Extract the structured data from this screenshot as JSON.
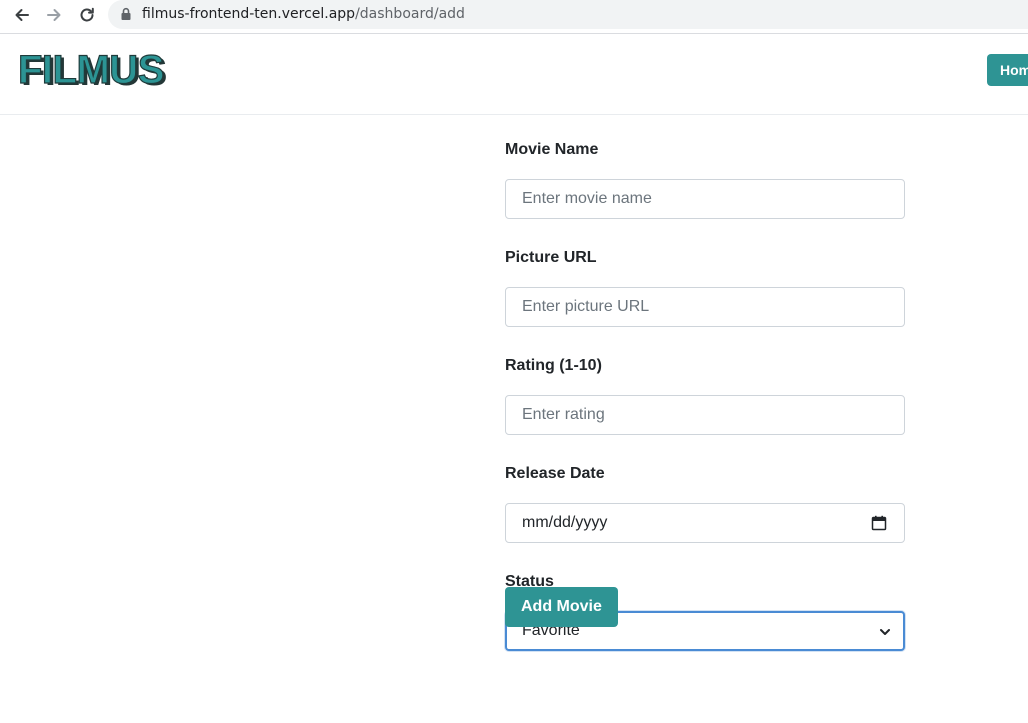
{
  "browser": {
    "url_host": "filmus-frontend-ten.vercel.app",
    "url_path": "/dashboard/add"
  },
  "header": {
    "logo_text": "FILMUS",
    "home_label": "Hom"
  },
  "form": {
    "movie_name": {
      "label": "Movie Name",
      "placeholder": "Enter movie name",
      "value": ""
    },
    "picture_url": {
      "label": "Picture URL",
      "placeholder": "Enter picture URL",
      "value": ""
    },
    "rating": {
      "label": "Rating (1-10)",
      "placeholder": "Enter rating",
      "value": ""
    },
    "release_date": {
      "label": "Release Date",
      "placeholder": "mm/dd/yyyy"
    },
    "status": {
      "label": "Status",
      "selected": "Favorite"
    },
    "submit_label": "Add Movie"
  },
  "colors": {
    "accent": "#2e9494",
    "focus": "#4a8bd4"
  },
  "icons": [
    "back-arrow-icon",
    "forward-arrow-icon",
    "reload-icon",
    "lock-icon",
    "calendar-icon",
    "chevron-down-icon"
  ]
}
